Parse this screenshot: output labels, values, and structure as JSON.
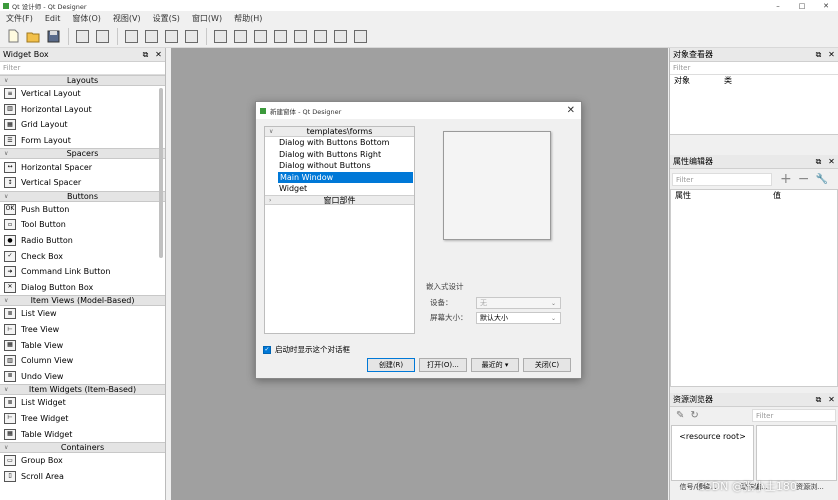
{
  "window": {
    "title": "Qt 设计师 - Qt Designer",
    "min": "–",
    "max": "□",
    "close": "✕"
  },
  "menu": [
    "文件(F)",
    "Edit",
    "窗体(O)",
    "视图(V)",
    "设置(S)",
    "窗口(W)",
    "帮助(H)"
  ],
  "widget_box": {
    "title": "Widget Box",
    "filter_placeholder": "Filter",
    "categories": [
      {
        "label": "Layouts",
        "items": [
          {
            "label": "Vertical Layout",
            "icon": "vertical-layout-icon"
          },
          {
            "label": "Horizontal Layout",
            "icon": "horizontal-layout-icon"
          },
          {
            "label": "Grid Layout",
            "icon": "grid-layout-icon"
          },
          {
            "label": "Form Layout",
            "icon": "form-layout-icon"
          }
        ]
      },
      {
        "label": "Spacers",
        "items": [
          {
            "label": "Horizontal Spacer",
            "icon": "horizontal-spacer-icon"
          },
          {
            "label": "Vertical Spacer",
            "icon": "vertical-spacer-icon"
          }
        ]
      },
      {
        "label": "Buttons",
        "items": [
          {
            "label": "Push Button",
            "icon": "push-button-icon"
          },
          {
            "label": "Tool Button",
            "icon": "tool-button-icon"
          },
          {
            "label": "Radio Button",
            "icon": "radio-button-icon"
          },
          {
            "label": "Check Box",
            "icon": "check-box-icon"
          },
          {
            "label": "Command Link Button",
            "icon": "command-link-icon"
          },
          {
            "label": "Dialog Button Box",
            "icon": "dialog-button-box-icon"
          }
        ]
      },
      {
        "label": "Item Views (Model-Based)",
        "items": [
          {
            "label": "List View",
            "icon": "list-view-icon"
          },
          {
            "label": "Tree View",
            "icon": "tree-view-icon"
          },
          {
            "label": "Table View",
            "icon": "table-view-icon"
          },
          {
            "label": "Column View",
            "icon": "column-view-icon"
          },
          {
            "label": "Undo View",
            "icon": "undo-view-icon"
          }
        ]
      },
      {
        "label": "Item Widgets (Item-Based)",
        "items": [
          {
            "label": "List Widget",
            "icon": "list-widget-icon"
          },
          {
            "label": "Tree Widget",
            "icon": "tree-widget-icon"
          },
          {
            "label": "Table Widget",
            "icon": "table-widget-icon"
          }
        ]
      },
      {
        "label": "Containers",
        "items": [
          {
            "label": "Group Box",
            "icon": "group-box-icon"
          },
          {
            "label": "Scroll Area",
            "icon": "scroll-area-icon"
          }
        ]
      }
    ]
  },
  "object_inspector": {
    "title": "对象查看器",
    "filter_placeholder": "Filter",
    "col1": "对象",
    "col2": "类"
  },
  "property_editor": {
    "title": "属性编辑器",
    "filter_placeholder": "Filter",
    "col1": "属性",
    "col2": "值",
    "add": "+",
    "remove": "−"
  },
  "resource_browser": {
    "title": "资源浏览器",
    "filter_placeholder": "Filter",
    "root": "<resource root>",
    "btn1": "信号/槽编...",
    "btn2": "动作编...",
    "btn3": "资源浏..."
  },
  "dialog": {
    "title": "新建窗体 - Qt Designer",
    "tree_header": "templates\\forms",
    "templates": [
      "Dialog with Buttons Bottom",
      "Dialog with Buttons Right",
      "Dialog without Buttons",
      "Main Window",
      "Widget"
    ],
    "selected_index": 3,
    "widgets_header": "窗口部件",
    "embedded": {
      "title": "嵌入式设计",
      "device_label": "设备：",
      "device_value": "无",
      "size_label": "屏幕大小：",
      "size_value": "默认大小"
    },
    "startup_checkbox": "启动时显示这个对话框",
    "buttons": {
      "create": "创建(R)",
      "open": "打开(O)...",
      "recent": "最近的",
      "close": "关闭(C)"
    }
  },
  "watermark": "CSDN @张小土180"
}
